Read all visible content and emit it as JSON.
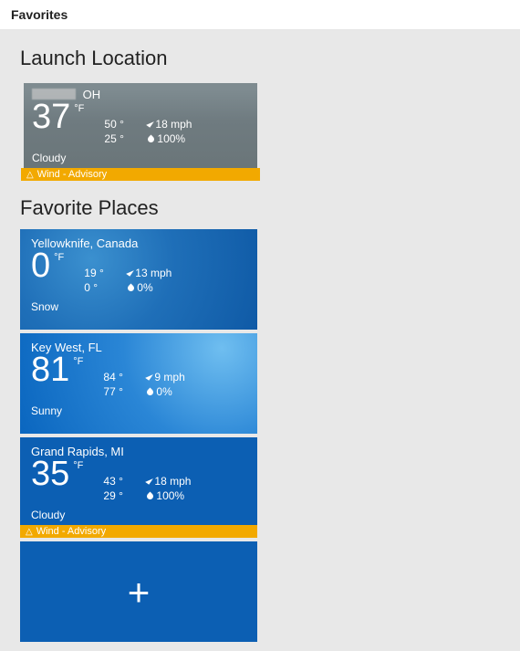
{
  "page": {
    "title": "Favorites",
    "section_launch": "Launch Location",
    "section_favorites": "Favorite Places"
  },
  "launch": {
    "location_state": "OH",
    "temp": "37",
    "unit": "°F",
    "high": "50 °",
    "low": "25 °",
    "wind": "18 mph",
    "humidity": "100%",
    "condition": "Cloudy",
    "advisory": "Wind - Advisory"
  },
  "favorites": [
    {
      "location": "Yellowknife, Canada",
      "temp": "0",
      "unit": "°F",
      "high": "19 °",
      "low": "0 °",
      "wind": "13 mph",
      "humidity": "0%",
      "condition": "Snow",
      "style": "snow",
      "advisory": null
    },
    {
      "location": "Key West, FL",
      "temp": "81",
      "unit": "°F",
      "high": "84 °",
      "low": "77 °",
      "wind": "9 mph",
      "humidity": "0%",
      "condition": "Sunny",
      "style": "sunny",
      "advisory": null
    },
    {
      "location": "Grand Rapids, MI",
      "temp": "35",
      "unit": "°F",
      "high": "43 °",
      "low": "29 °",
      "wind": "18 mph",
      "humidity": "100%",
      "condition": "Cloudy",
      "style": "cloudy-blue",
      "advisory": "Wind - Advisory"
    }
  ],
  "add_tile": {
    "label": "+"
  }
}
